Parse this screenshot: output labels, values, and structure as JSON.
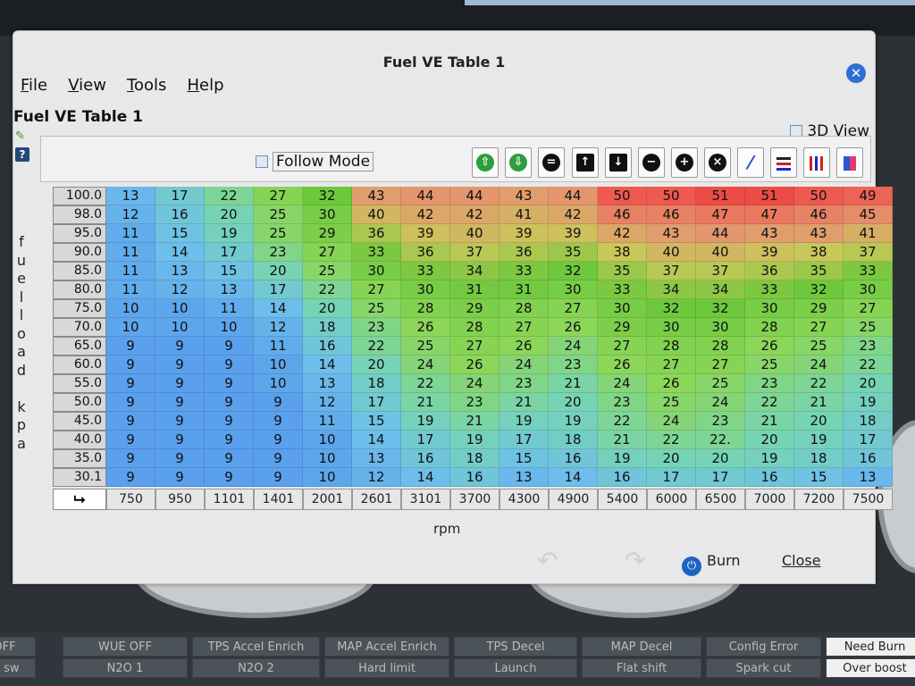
{
  "window": {
    "title": "Fuel VE Table 1",
    "subtitle": "Fuel VE Table 1"
  },
  "menu": [
    {
      "u": "F",
      "rest": "ile"
    },
    {
      "u": "V",
      "rest": "iew"
    },
    {
      "u": "T",
      "rest": "ools"
    },
    {
      "u": "H",
      "rest": "elp"
    }
  ],
  "controls": {
    "view3d_label": "3D View",
    "follow_mode_label": "Follow Mode",
    "burn_label": "Burn",
    "close_label": "Close",
    "corner_symbol": "⮡"
  },
  "toolbar_icons": [
    "arrow-up-green-icon",
    "arrow-down-green-icon",
    "set-equal-icon",
    "increment-up-icon",
    "increment-down-icon",
    "minus-icon",
    "plus-icon",
    "multiply-icon",
    "pencil-edit-icon",
    "interpolate-rows-icon",
    "interpolate-cols-icon",
    "color-scale-icon"
  ],
  "table": {
    "y_axis_label": [
      "f",
      "u",
      "e",
      "l",
      "l",
      "o",
      "a",
      "d",
      "",
      "k",
      "p",
      "a"
    ],
    "x_axis_label": "rpm",
    "load": [
      "100.0",
      "98.0",
      "95.0",
      "90.0",
      "85.0",
      "80.0",
      "75.0",
      "70.0",
      "65.0",
      "60.0",
      "55.0",
      "50.0",
      "45.0",
      "40.0",
      "35.0",
      "30.1"
    ],
    "rpm": [
      "750",
      "950",
      "1101",
      "1401",
      "2001",
      "2601",
      "3101",
      "3700",
      "4300",
      "4900",
      "5400",
      "6000",
      "6500",
      "7000",
      "7200",
      "7500"
    ],
    "values": [
      [
        "13",
        "17",
        "22",
        "27",
        "32",
        "43",
        "44",
        "44",
        "43",
        "44",
        "50",
        "50",
        "51",
        "51",
        "50",
        "49"
      ],
      [
        "12",
        "16",
        "20",
        "25",
        "30",
        "40",
        "42",
        "42",
        "41",
        "42",
        "46",
        "46",
        "47",
        "47",
        "46",
        "45"
      ],
      [
        "11",
        "15",
        "19",
        "25",
        "29",
        "36",
        "39",
        "40",
        "39",
        "39",
        "42",
        "43",
        "44",
        "43",
        "43",
        "41"
      ],
      [
        "11",
        "14",
        "17",
        "23",
        "27",
        "33",
        "36",
        "37",
        "36",
        "35",
        "38",
        "40",
        "40",
        "39",
        "38",
        "37"
      ],
      [
        "11",
        "13",
        "15",
        "20",
        "25",
        "30",
        "33",
        "34",
        "33",
        "32",
        "35",
        "37",
        "37",
        "36",
        "35",
        "33"
      ],
      [
        "11",
        "12",
        "13",
        "17",
        "22",
        "27",
        "30",
        "31",
        "31",
        "30",
        "33",
        "34",
        "34",
        "33",
        "32",
        "30"
      ],
      [
        "10",
        "10",
        "11",
        "14",
        "20",
        "25",
        "28",
        "29",
        "28",
        "27",
        "30",
        "32",
        "32",
        "30",
        "29",
        "27"
      ],
      [
        "10",
        "10",
        "10",
        "12",
        "18",
        "23",
        "26",
        "28",
        "27",
        "26",
        "29",
        "30",
        "30",
        "28",
        "27",
        "25"
      ],
      [
        "9",
        "9",
        "9",
        "11",
        "16",
        "22",
        "25",
        "27",
        "26",
        "24",
        "27",
        "28",
        "28",
        "26",
        "25",
        "23"
      ],
      [
        "9",
        "9",
        "9",
        "10",
        "14",
        "20",
        "24",
        "26",
        "24",
        "23",
        "26",
        "27",
        "27",
        "25",
        "24",
        "22"
      ],
      [
        "9",
        "9",
        "9",
        "10",
        "13",
        "18",
        "22",
        "24",
        "23",
        "21",
        "24",
        "26",
        "25",
        "23",
        "22",
        "20"
      ],
      [
        "9",
        "9",
        "9",
        "9",
        "12",
        "17",
        "21",
        "23",
        "21",
        "20",
        "23",
        "25",
        "24",
        "22",
        "21",
        "19"
      ],
      [
        "9",
        "9",
        "9",
        "9",
        "11",
        "15",
        "19",
        "21",
        "19",
        "19",
        "22",
        "24",
        "23",
        "21",
        "20",
        "18"
      ],
      [
        "9",
        "9",
        "9",
        "9",
        "10",
        "14",
        "17",
        "19",
        "17",
        "18",
        "21",
        "22",
        "22.",
        "20",
        "19",
        "17"
      ],
      [
        "9",
        "9",
        "9",
        "9",
        "10",
        "13",
        "16",
        "18",
        "15",
        "16",
        "19",
        "20",
        "20",
        "19",
        "18",
        "16"
      ],
      [
        "9",
        "9",
        "9",
        "9",
        "10",
        "12",
        "14",
        "16",
        "13",
        "14",
        "16",
        "17",
        "17",
        "16",
        "15",
        "13"
      ]
    ]
  },
  "status_rows": [
    [
      "OFF",
      "WUE OFF",
      "TPS Accel Enrich",
      "MAP Accel Enrich",
      "TPS Decel",
      "MAP Decel",
      "Config Error",
      "Need Burn"
    ],
    [
      "ol sw",
      "N2O 1",
      "N2O 2",
      "Hard limit",
      "Launch",
      "Flat shift",
      "Spark cut",
      "Over boost"
    ]
  ]
}
